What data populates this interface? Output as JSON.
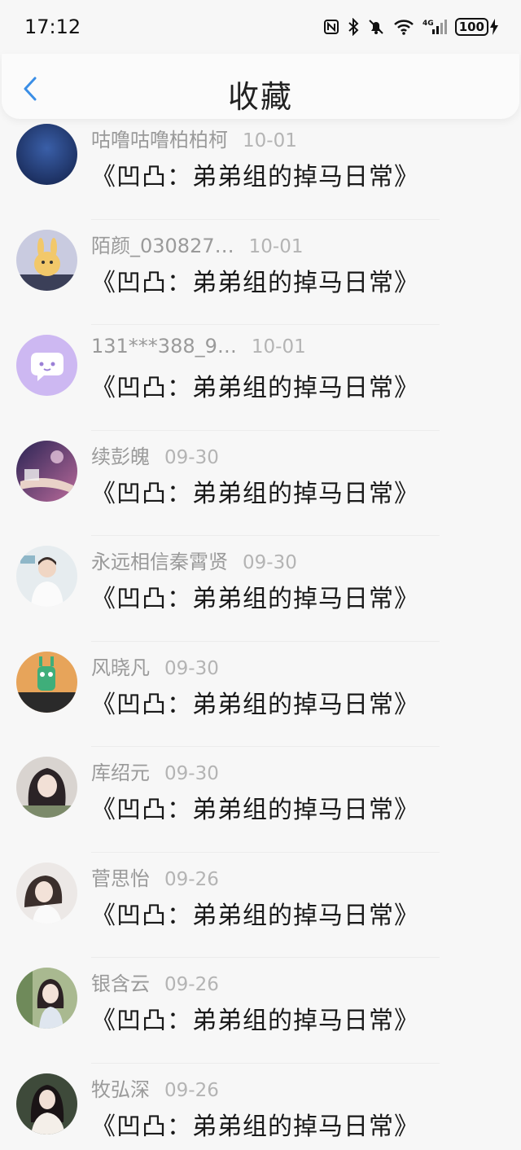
{
  "status_bar": {
    "time": "17:12",
    "battery": "100"
  },
  "header": {
    "title": "收藏"
  },
  "items": [
    {
      "name": "咕噜咕噜柏柏柯",
      "date": "10-01",
      "content": "《凹凸：弟弟组的掉马日常》",
      "avatar": "dark-blue-avatar"
    },
    {
      "name": "陌颜_030827…",
      "date": "10-01",
      "content": "《凹凸：弟弟组的掉马日常》",
      "avatar": "bunny-avatar"
    },
    {
      "name": "131***388_9…",
      "date": "10-01",
      "content": "《凹凸：弟弟组的掉马日常》",
      "avatar": "chat-bubble-avatar"
    },
    {
      "name": "续彭魄",
      "date": "09-30",
      "content": "《凹凸：弟弟组的掉马日常》",
      "avatar": "book-avatar"
    },
    {
      "name": "永远相信秦霄贤",
      "date": "09-30",
      "content": "《凹凸：弟弟组的掉马日常》",
      "avatar": "person-avatar"
    },
    {
      "name": "风晓凡",
      "date": "09-30",
      "content": "《凹凸：弟弟组的掉马日常》",
      "avatar": "cartoon-avatar"
    },
    {
      "name": "库绍元",
      "date": "09-30",
      "content": "《凹凸：弟弟组的掉马日常》",
      "avatar": "girl-avatar"
    },
    {
      "name": "菅思怡",
      "date": "09-26",
      "content": "《凹凸：弟弟组的掉马日常》",
      "avatar": "girl-light-avatar"
    },
    {
      "name": "银含云",
      "date": "09-26",
      "content": "《凹凸：弟弟组的掉马日常》",
      "avatar": "girl-green-avatar"
    },
    {
      "name": "牧弘深",
      "date": "09-26",
      "content": "《凹凸：弟弟组的掉马日常》",
      "avatar": "girl-dark-avatar"
    }
  ],
  "colors": {
    "accent": "#3a8ee6",
    "background": "#f7f7f7"
  }
}
